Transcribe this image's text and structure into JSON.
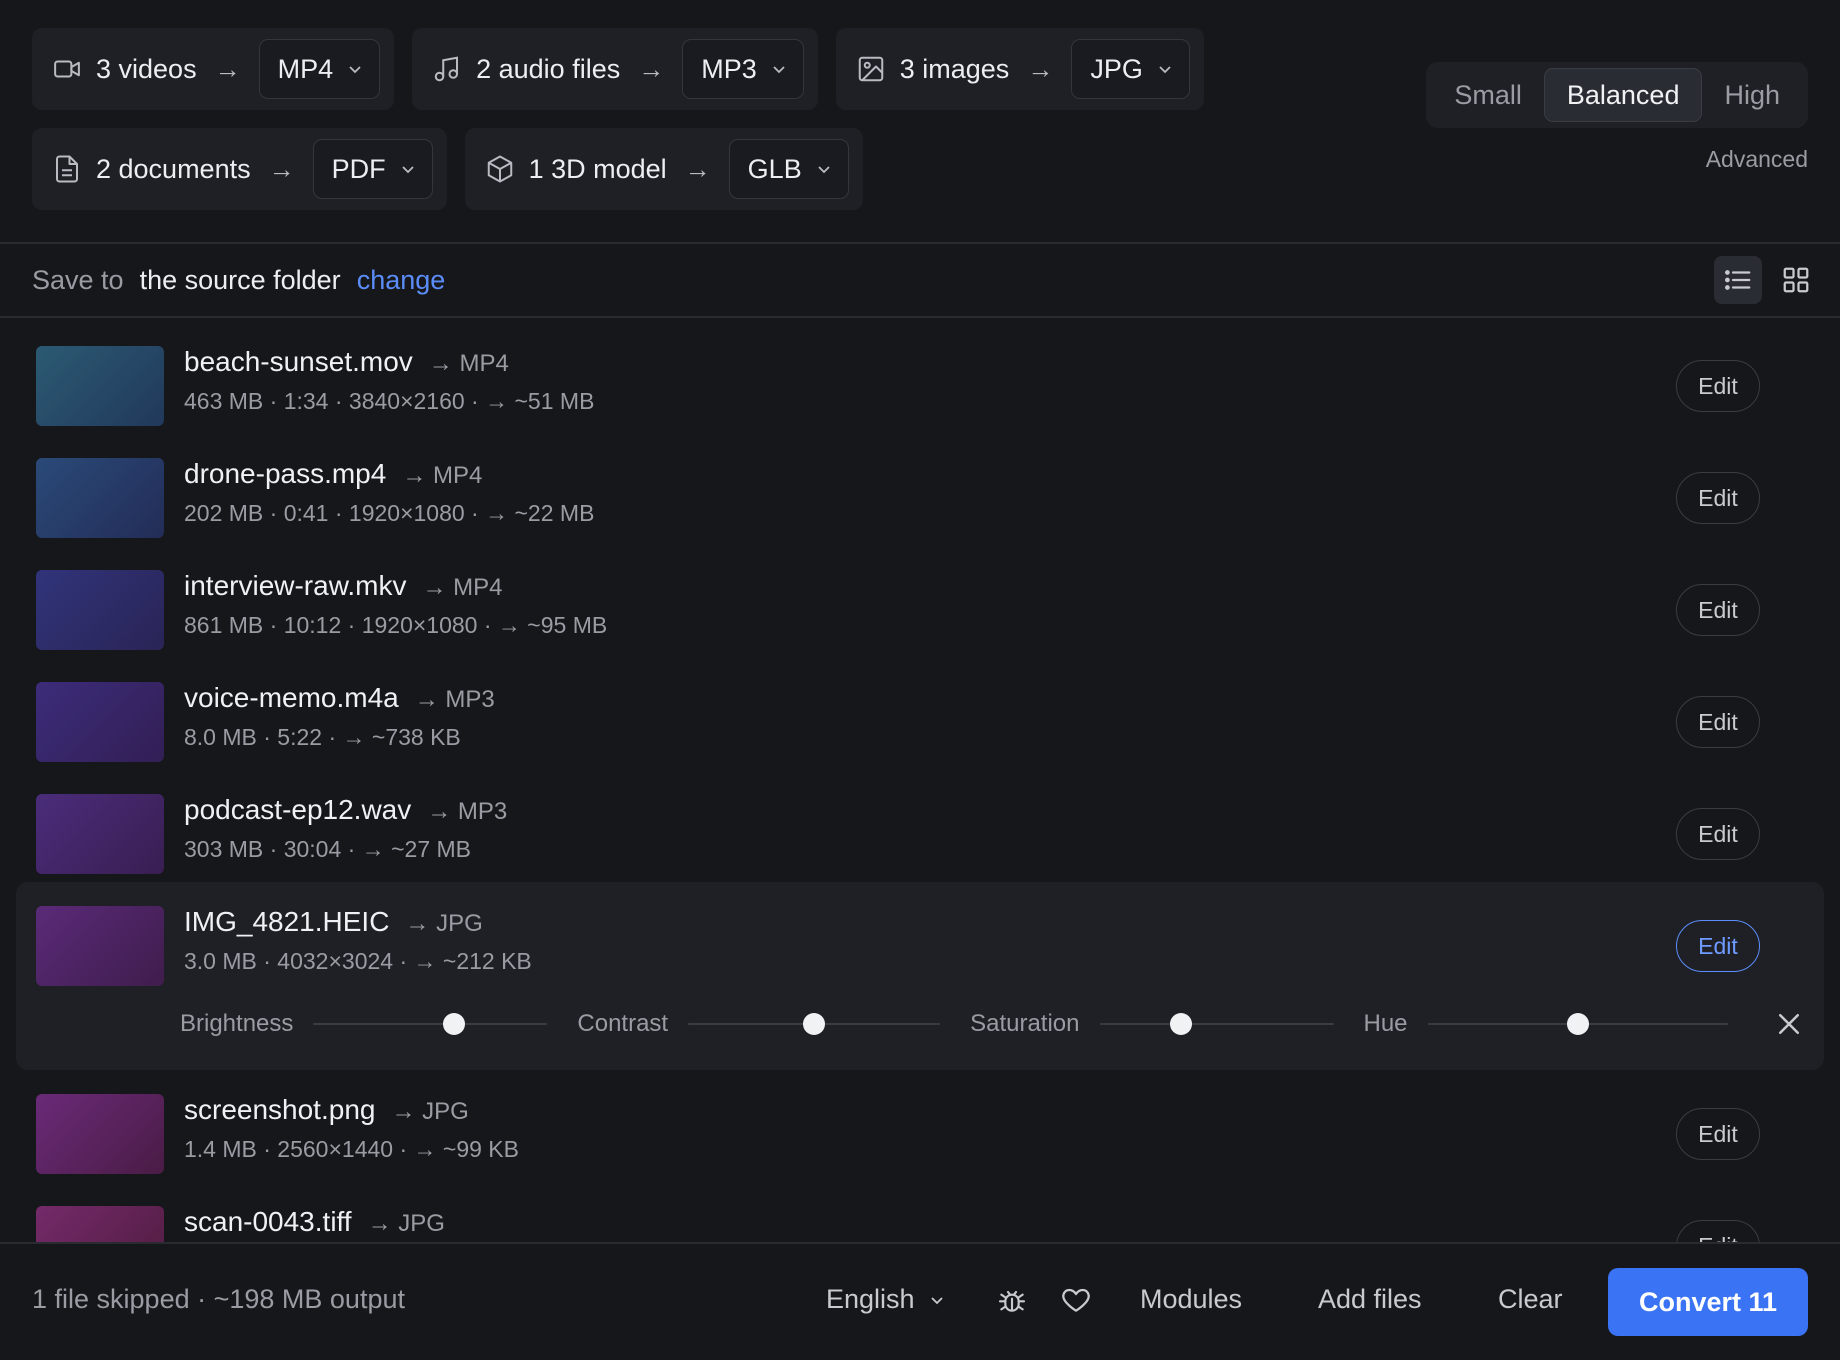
{
  "groups": [
    {
      "icon": "video-camera-icon",
      "label": "3 videos",
      "arrow": "→",
      "format": "MP4"
    },
    {
      "icon": "music-note-icon",
      "label": "2 audio files",
      "arrow": "→",
      "format": "MP3"
    },
    {
      "icon": "image-icon",
      "label": "3 images",
      "arrow": "→",
      "format": "JPG"
    },
    {
      "icon": "document-icon",
      "label": "2 documents",
      "arrow": "→",
      "format": "PDF"
    },
    {
      "icon": "cube-icon",
      "label": "1 3D model",
      "arrow": "→",
      "format": "GLB"
    }
  ],
  "quality": {
    "options": [
      "Small",
      "Balanced",
      "High"
    ],
    "selected": "Balanced",
    "advanced_label": "Advanced"
  },
  "save": {
    "label": "Save to",
    "location": "the source folder",
    "change_label": "change"
  },
  "view": {
    "mode": "list"
  },
  "files": [
    {
      "name": "beach-sunset.mov",
      "target": "→ MP4",
      "meta": "463 MB · 1:34 · 3840×2160 · → ~51 MB",
      "edit_label": "Edit",
      "color_a": "#2b5a73",
      "color_b": "#21385a"
    },
    {
      "name": "drone-pass.mp4",
      "target": "→ MP4",
      "meta": "202 MB · 0:41 · 1920×1080 · → ~22 MB",
      "edit_label": "Edit",
      "color_a": "#2a4a78",
      "color_b": "#232c57"
    },
    {
      "name": "interview-raw.mkv",
      "target": "→ MP4",
      "meta": "861 MB · 10:12 · 1920×1080 · → ~95 MB",
      "edit_label": "Edit",
      "color_a": "#30347a",
      "color_b": "#2a2456"
    },
    {
      "name": "voice-memo.m4a",
      "target": "→ MP3",
      "meta": "8.0 MB · 5:22 · → ~738 KB",
      "edit_label": "Edit",
      "color_a": "#3c2c7a",
      "color_b": "#321f55"
    },
    {
      "name": "podcast-ep12.wav",
      "target": "→ MP3",
      "meta": "303 MB · 30:04 · → ~27 MB",
      "edit_label": "Edit",
      "color_a": "#4a2c7a",
      "color_b": "#391e52"
    },
    {
      "name": "IMG_4821.HEIC",
      "target": "→ JPG",
      "meta": "3.0 MB · 4032×3024 · → ~212 KB",
      "edit_label": "Edit",
      "color_a": "#5a2a78",
      "color_b": "#3f1d4c",
      "selected": true
    },
    {
      "name": "screenshot.png",
      "target": "→ JPG",
      "meta": "1.4 MB · 2560×1440 · → ~99 KB",
      "edit_label": "Edit",
      "color_a": "#6a2a78",
      "color_b": "#4a1c45"
    },
    {
      "name": "scan-0043.tiff",
      "target": "→ JPG",
      "meta": "",
      "edit_label": "Edit",
      "color_a": "#742a6a",
      "color_b": "#4f1c3e"
    }
  ],
  "adjustments": [
    {
      "label": "Brightness",
      "value": 0.6
    },
    {
      "label": "Contrast",
      "value": 0.5
    },
    {
      "label": "Saturation",
      "value": 0.35
    },
    {
      "label": "Hue",
      "value": 0.5
    }
  ],
  "footer": {
    "summary": "1 file skipped · ~198 MB output",
    "language": "English",
    "modules_label": "Modules",
    "add_files_label": "Add files",
    "clear_label": "Clear",
    "convert_label": "Convert 11"
  },
  "colors": {
    "accent": "#3b73f5",
    "link": "#5b8cf8",
    "background": "#16171b"
  }
}
